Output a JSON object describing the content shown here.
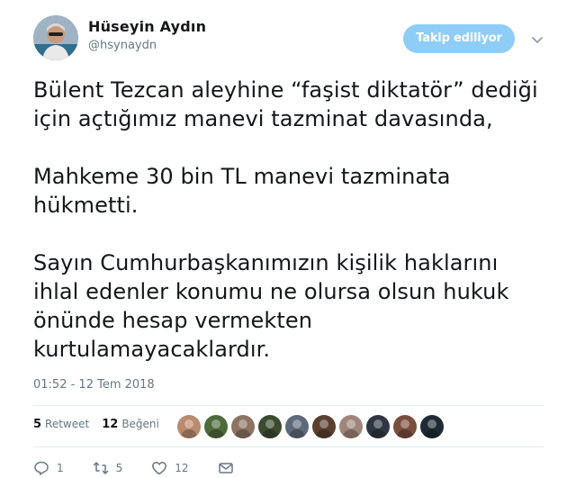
{
  "author": {
    "display_name": "Hüseyin Aydın",
    "screen_name": "@hsynaydn"
  },
  "follow_button": {
    "label": "Takip ediliyor"
  },
  "tweet": {
    "paragraphs": [
      "Bülent Tezcan aleyhine “faşist diktatör” dediği\niçin açtığımız manevi tazminat davasında,",
      "Mahkeme 30 bin TL manevi tazminata\nhükmetti.",
      "Sayın Cumhurbaşkanımızın kişilik haklarını\nihlal edenler konumu ne olursa olsun hukuk\nönünde hesap vermekten\nkurtulamayacaklardır."
    ],
    "timestamp": "01:52 - 12 Tem 2018"
  },
  "stats": {
    "retweets": {
      "count": "5",
      "label": "Retweet"
    },
    "likes": {
      "count": "12",
      "label": "Beğeni"
    }
  },
  "likers": [
    {
      "color": "#b98a6e"
    },
    {
      "color": "#4d6b3a"
    },
    {
      "color": "#8e7363"
    },
    {
      "color": "#3b4b2e"
    },
    {
      "color": "#5c6a7c"
    },
    {
      "color": "#5a3e2f"
    },
    {
      "color": "#a0857b"
    },
    {
      "color": "#2f3742"
    },
    {
      "color": "#7a4e3d"
    },
    {
      "color": "#1f2a35"
    }
  ],
  "actions": {
    "reply_count": "1",
    "retweet_count": "5",
    "like_count": "12"
  },
  "colors": {
    "follow_button_bg": "#8ecdf8",
    "secondary_text": "#657786",
    "divider": "#e6ecf0"
  }
}
